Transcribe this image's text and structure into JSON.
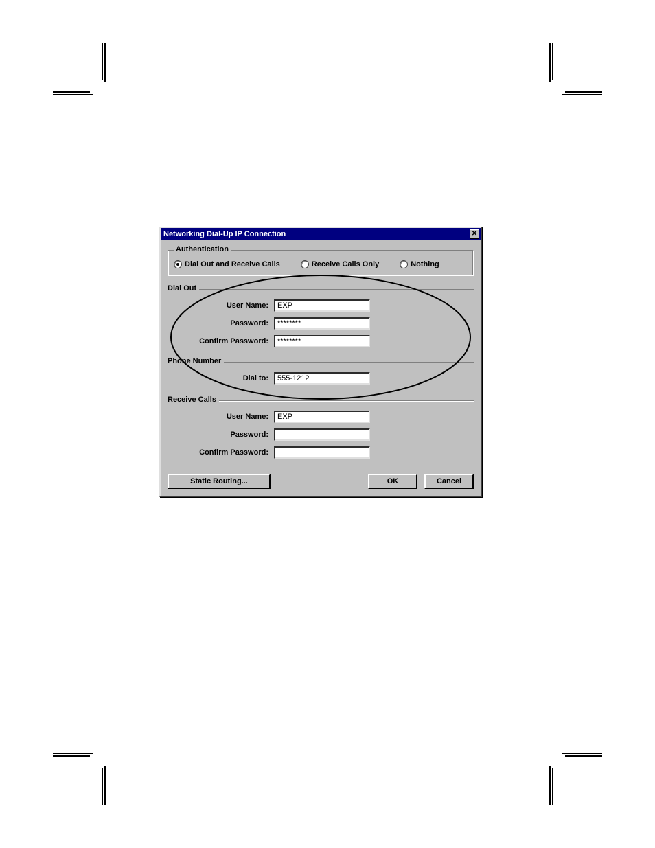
{
  "dialog": {
    "title": "Networking Dial-Up IP Connection",
    "close_x": "✕"
  },
  "auth": {
    "legend": "Authentication",
    "radio1": "Dial Out and Receive Calls",
    "radio2": "Receive Calls Only",
    "radio3": "Nothing",
    "selected": 0
  },
  "dialout": {
    "legend": "Dial Out",
    "user_label": "User Name:",
    "user_value": "EXP",
    "pass_label": "Password:",
    "pass_value": "********",
    "confirm_label": "Confirm Password:",
    "confirm_value": "********"
  },
  "phone": {
    "legend": "Phone Number",
    "dialto_label": "Dial to:",
    "dialto_value": "555-1212"
  },
  "receive": {
    "legend": "Receive Calls",
    "user_label": "User Name:",
    "user_value": "EXP",
    "pass_label": "Password:",
    "pass_value": "",
    "confirm_label": "Confirm Password:",
    "confirm_value": ""
  },
  "buttons": {
    "static_routing": "Static Routing...",
    "ok": "OK",
    "cancel": "Cancel"
  }
}
